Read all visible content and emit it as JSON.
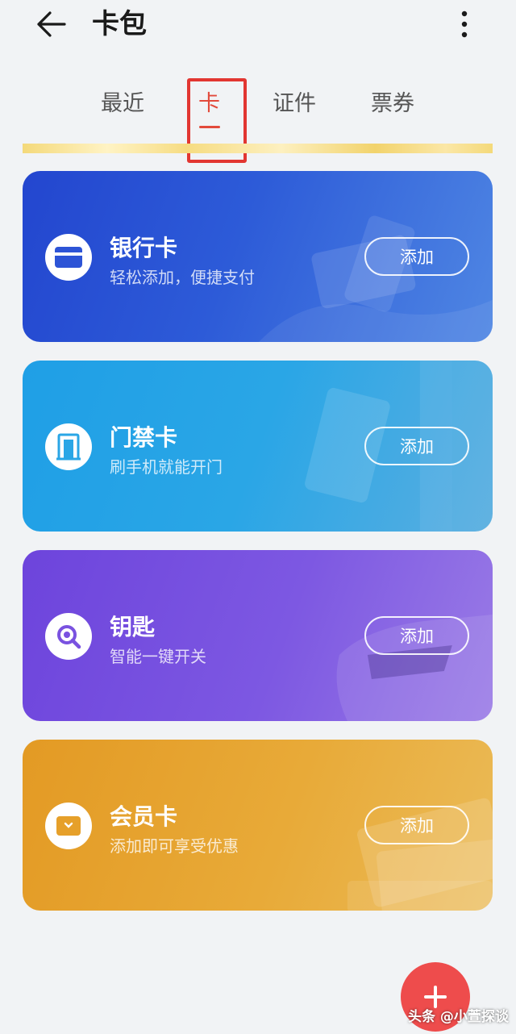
{
  "header": {
    "title": "卡包",
    "back_icon": "back-arrow-icon",
    "more_icon": "more-vertical-icon"
  },
  "tabs": [
    {
      "label": "最近",
      "active": false
    },
    {
      "label": "卡",
      "active": true
    },
    {
      "label": "证件",
      "active": false
    },
    {
      "label": "票券",
      "active": false
    }
  ],
  "cards": [
    {
      "title": "银行卡",
      "subtitle": "轻松添加，便捷支付",
      "button": "添加",
      "icon": "bank-card-icon",
      "color": "#2d54d6"
    },
    {
      "title": "门禁卡",
      "subtitle": "刷手机就能开门",
      "button": "添加",
      "icon": "door-icon",
      "color": "#27a2e6"
    },
    {
      "title": "钥匙",
      "subtitle": "智能一键开关",
      "button": "添加",
      "icon": "key-search-icon",
      "color": "#7a52e0"
    },
    {
      "title": "会员卡",
      "subtitle": "添加即可享受优惠",
      "button": "添加",
      "icon": "member-card-icon",
      "color": "#e6a02a"
    }
  ],
  "fab": {
    "icon": "plus-icon",
    "color": "#ee4c4c"
  },
  "watermark": "头条 @小萱探谈"
}
